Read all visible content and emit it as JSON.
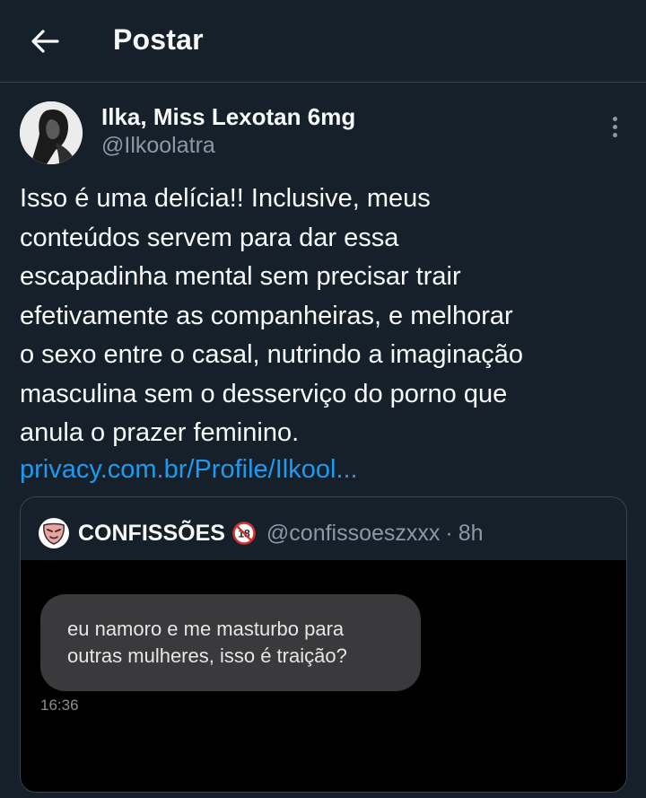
{
  "header": {
    "back_icon": "arrow-left-icon",
    "title": "Postar"
  },
  "author": {
    "name": "Ilka, Miss Lexotan 6mg",
    "handle": "@Ilkoolatra",
    "avatar_icon": "profile-photo-avatar"
  },
  "tweet": {
    "lines": [
      "Isso é uma delícia!! Inclusive, meus",
      "conteúdos servem para dar essa",
      "escapadinha mental sem precisar trair",
      "efetivamente as companheiras, e melhorar",
      "o sexo entre o casal, nutrindo a imaginação",
      "masculina sem o desserviço do porno que",
      "anula o prazer feminino."
    ],
    "link": "privacy.com.br/Profile/Ilkool..."
  },
  "quote": {
    "name": "CONFISSÕES",
    "handle": "@confissoeszxxx",
    "separator": "·",
    "time": "8h",
    "badge_icon": "no-under-18-icon",
    "avatar_icon": "mask-avatar-icon",
    "message_lines": [
      "eu namoro e me masturbo para",
      "outras mulheres, isso é traição?"
    ],
    "message_time": "16:36"
  },
  "colors": {
    "background": "#15202b",
    "text": "#f7f9f9",
    "secondary": "#8b98a5",
    "link": "#1d9bf0",
    "border": "#38444d"
  }
}
